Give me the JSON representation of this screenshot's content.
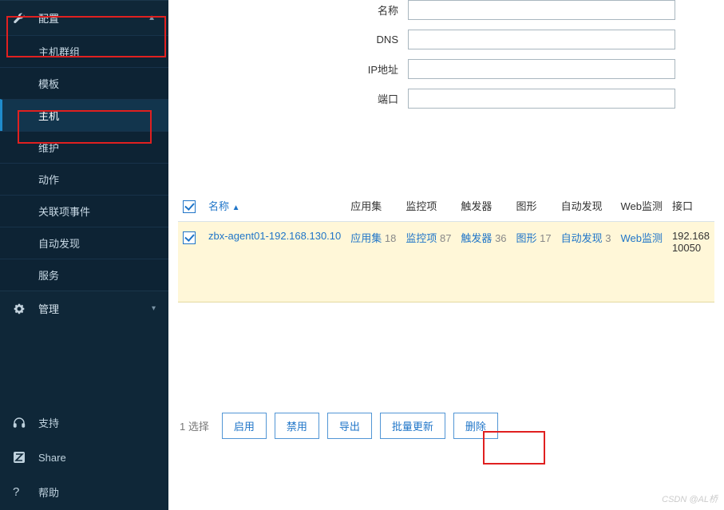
{
  "sidebar": {
    "config": {
      "label": "配置",
      "icon": "wrench",
      "expanded": true,
      "items": [
        {
          "label": "主机群组"
        },
        {
          "label": "模板"
        },
        {
          "label": "主机",
          "active": true
        },
        {
          "label": "维护"
        },
        {
          "label": "动作"
        },
        {
          "label": "关联项事件"
        },
        {
          "label": "自动发现"
        },
        {
          "label": "服务"
        }
      ]
    },
    "admin": {
      "label": "管理",
      "icon": "gear",
      "expanded": false
    },
    "support": {
      "label": "支持",
      "icon": "headset"
    },
    "share": {
      "label": "Share",
      "icon": "z"
    },
    "help": {
      "label": "帮助",
      "icon": "question"
    }
  },
  "filter": {
    "name_label": "名称",
    "dns_label": "DNS",
    "ip_label": "IP地址",
    "port_label": "端口",
    "name": "",
    "dns": "",
    "ip": "",
    "port": ""
  },
  "table": {
    "headers": {
      "name": "名称",
      "apps": "应用集",
      "items": "监控项",
      "triggers": "触发器",
      "graphs": "图形",
      "discovery": "自动发现",
      "web": "Web监测",
      "iface": "接口"
    },
    "row": {
      "name": "zbx-agent01-192.168.130.10",
      "apps": {
        "label": "应用集",
        "count": "18"
      },
      "items": {
        "label": "监控项",
        "count": "87"
      },
      "triggers": {
        "label": "触发器",
        "count": "36"
      },
      "graphs": {
        "label": "图形",
        "count": "17"
      },
      "discovery": {
        "label": "自动发现",
        "count": "3"
      },
      "web": "Web监测",
      "iface": "192.168\n10050"
    }
  },
  "footer": {
    "selected": "1 选择",
    "enable": "启用",
    "disable": "禁用",
    "export": "导出",
    "mass": "批量更新",
    "delete": "删除"
  },
  "watermark": "CSDN @AL桥"
}
